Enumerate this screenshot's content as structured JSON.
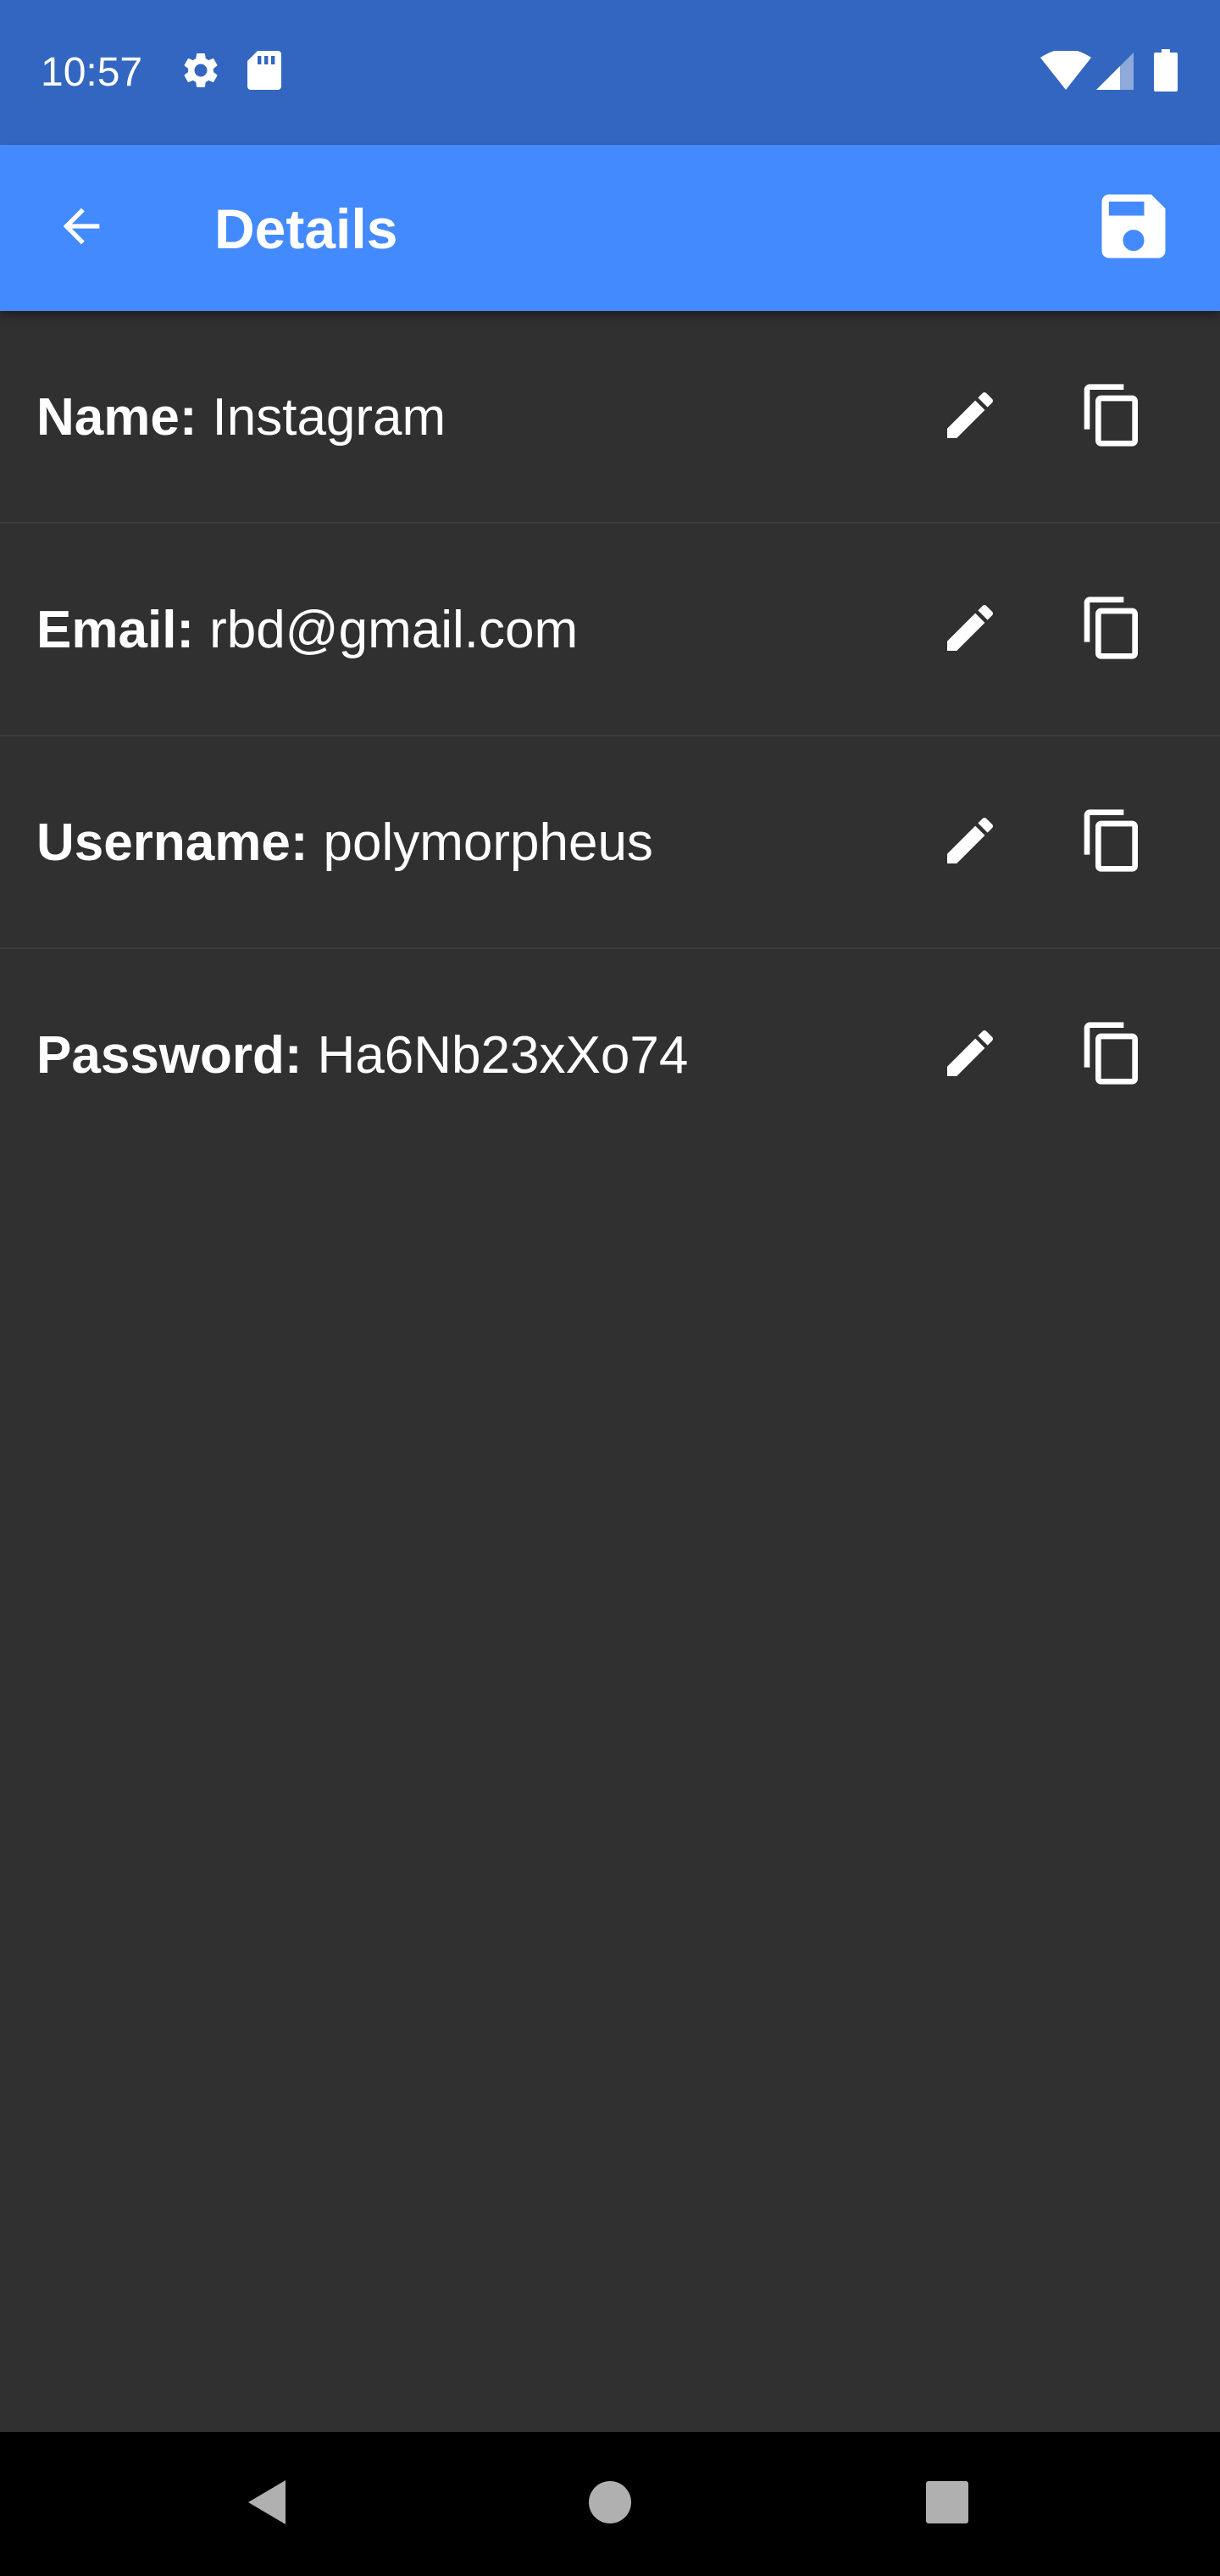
{
  "status_bar": {
    "time": "10:57",
    "icons": [
      "settings-icon",
      "sd-card-icon",
      "wifi-icon",
      "cell-signal-icon",
      "battery-icon"
    ]
  },
  "app_bar": {
    "title": "Details",
    "back_icon": "arrow-back-icon",
    "save_icon": "floppy-disk-icon"
  },
  "details": [
    {
      "label": "Name:",
      "value": "Instagram",
      "edit_icon": "pencil-icon",
      "copy_icon": "copy-icon"
    },
    {
      "label": "Email:",
      "value": "rbd@gmail.com",
      "edit_icon": "pencil-icon",
      "copy_icon": "copy-icon"
    },
    {
      "label": "Username:",
      "value": "polymorpheus",
      "edit_icon": "pencil-icon",
      "copy_icon": "copy-icon"
    },
    {
      "label": "Password:",
      "value": "Ha6Nb23xXo74",
      "edit_icon": "pencil-icon",
      "copy_icon": "copy-icon"
    }
  ],
  "nav_bar": {
    "icons": [
      "back-triangle-icon",
      "home-circle-icon",
      "recents-square-icon"
    ]
  },
  "colors": {
    "status_bar": "#3366c0",
    "app_bar": "#448aff",
    "background": "#303030",
    "divider": "#3b3b3b",
    "text": "#ffffff",
    "nav_bar": "#000000",
    "nav_icons": "#b0b0b0"
  }
}
